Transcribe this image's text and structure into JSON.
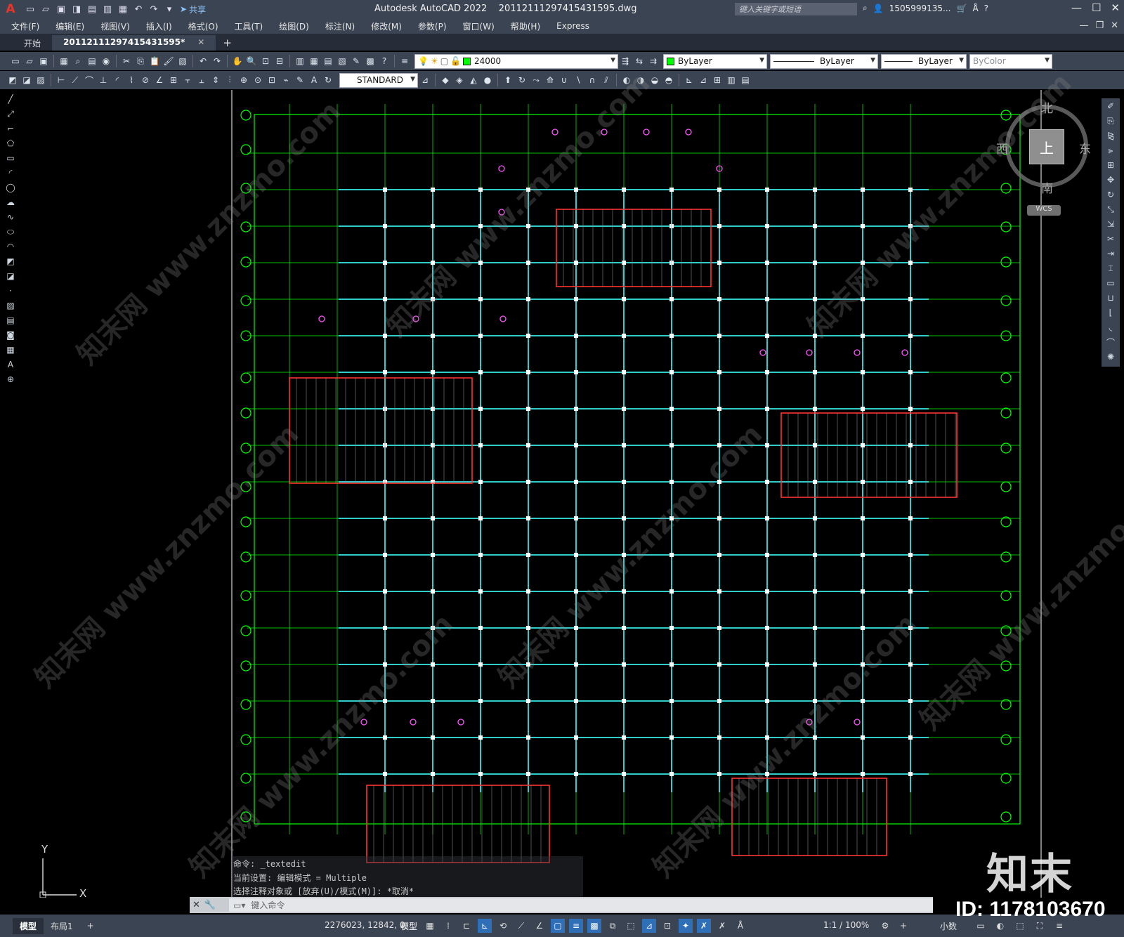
{
  "titlebar": {
    "app_logo": "A",
    "share_label": "共享",
    "title": "Autodesk AutoCAD 2022    20112111297415431595.dwg",
    "search_placeholder": "键入关键字或短语",
    "user": "1505999135...",
    "icons": [
      "new-icon",
      "open-icon",
      "save-icon",
      "save-as-icon",
      "publish-icon",
      "plot-icon",
      "undo-icon",
      "redo-icon"
    ]
  },
  "menu": {
    "items": [
      "文件(F)",
      "编辑(E)",
      "视图(V)",
      "插入(I)",
      "格式(O)",
      "工具(T)",
      "绘图(D)",
      "标注(N)",
      "修改(M)",
      "参数(P)",
      "窗口(W)",
      "帮助(H)",
      "Express"
    ]
  },
  "tabs": {
    "start": "开始",
    "document": "20112111297415431595*"
  },
  "toolbar": {
    "layer_name": "24000",
    "color": "ByLayer",
    "linetype": "ByLayer",
    "lineweight": "ByLayer",
    "plotstyle": "ByColor",
    "text_style": "STANDARD"
  },
  "viewcube": {
    "north": "北",
    "south": "南",
    "east": "东",
    "west": "西",
    "face": "上",
    "wcs": "WCS"
  },
  "ucs": {
    "y": "Y",
    "x": "X"
  },
  "command": {
    "history": [
      "命令: _textedit",
      "当前设置: 编辑模式 = Multiple",
      "选择注释对象或 [放弃(U)/模式(M)]: *取消*"
    ],
    "prompt": "键入命令"
  },
  "status": {
    "layout_tabs": [
      "模型",
      "布局1"
    ],
    "coords": "2276023, 12842, 0",
    "model_label": "模型",
    "scale": "1:1 / 100%",
    "units": "小数"
  },
  "watermark": {
    "logo": "知末",
    "id": "ID: 1178103670",
    "diagonal": "知末网 www.znzmo.com"
  },
  "colors": {
    "chrome": "#3b4453",
    "grid_lines": "#00ff00",
    "beams": "#33cccc",
    "columns": "#ffffff",
    "shear_walls": "#ff3333",
    "bay_markers": "#ff55ff",
    "axis_bubble": "#00ff00"
  }
}
